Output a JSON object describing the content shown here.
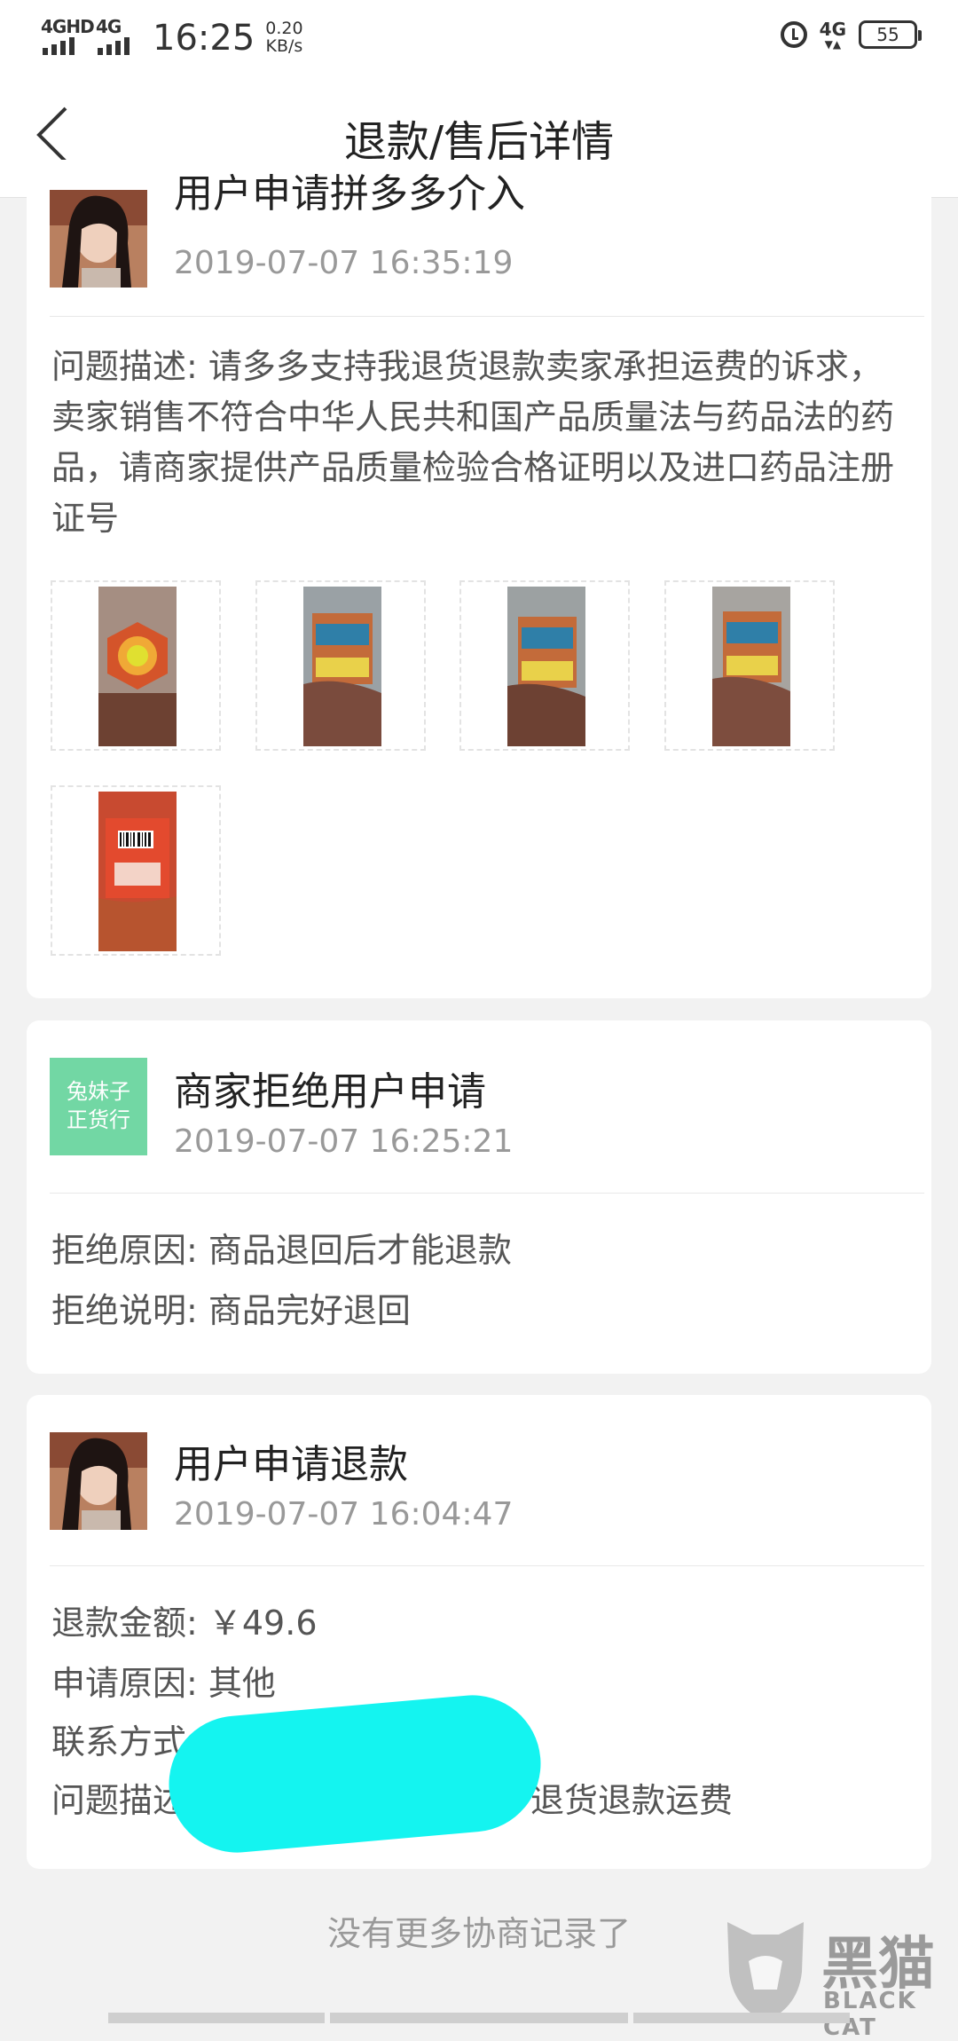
{
  "status_bar": {
    "signal_1_label": "4GHD",
    "signal_2_label": "4G",
    "time": "16:25",
    "speed_value": "0.20",
    "speed_unit": "KB/s",
    "network_right": "4G",
    "battery": "55"
  },
  "nav": {
    "title": "退款/售后详情"
  },
  "records": [
    {
      "title": "用户申请拼多多介入",
      "time": "2019-07-07 16:35:19",
      "description": "问题描述: 请多多支持我退货退款卖家承担运费的诉求，卖家销售不符合中华人民共和国产品质量法与药品法的药品，请商家提供产品质量检验合格证明以及进口药品注册证号",
      "image_count": 5
    },
    {
      "avatar_line1": "兔妹子",
      "avatar_line2": "正货行",
      "title": "商家拒绝用户申请",
      "time": "2019-07-07 16:25:21",
      "reject_reason": "拒绝原因: 商品退回后才能退款",
      "reject_note": "拒绝说明: 商品完好退回"
    },
    {
      "title": "用户申请退款",
      "time": "2019-07-07 16:04:47",
      "refund_amount": "退款金额: ￥49.6",
      "apply_reason": "申请原因: 其他",
      "contact": "联系方式",
      "problem_prefix": "问题描述",
      "problem_suffix": "退货退款运费"
    }
  ],
  "footer": {
    "no_more": "没有更多协商记录了"
  },
  "watermark": {
    "text": "黑猫",
    "sub": "BLACK CAT"
  },
  "colors": {
    "shop_avatar_bg": "#72d7a4",
    "redaction": "#14f4f0"
  }
}
